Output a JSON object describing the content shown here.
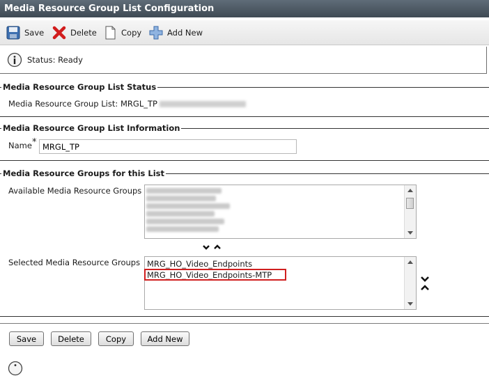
{
  "window": {
    "title": "Media Resource Group List Configuration"
  },
  "toolbar": {
    "save_label": "Save",
    "delete_label": "Delete",
    "copy_label": "Copy",
    "add_new_label": "Add New"
  },
  "status": {
    "text": "Status: Ready"
  },
  "mrgl_status": {
    "legend": "Media Resource Group List Status",
    "label": "Media Resource Group List:",
    "value": "MRGL_TP"
  },
  "mrgl_info": {
    "legend": "Media Resource Group List Information",
    "name_label": "Name",
    "required_mark": "*",
    "name_value": "MRGL_TP"
  },
  "groups": {
    "legend": "Media Resource Groups for this List",
    "available_label": "Available Media Resource Groups",
    "selected_label": "Selected Media Resource Groups",
    "selected_items": [
      "MRG_HO_Video_Endpoints",
      "MRG_HO_Video_Endpoints-MTP"
    ]
  },
  "buttons": {
    "save": "Save",
    "delete": "Delete",
    "copy": "Copy",
    "add_new": "Add New"
  },
  "colors": {
    "titlebar": "#4e5a64",
    "highlight": "#d01f1f"
  }
}
